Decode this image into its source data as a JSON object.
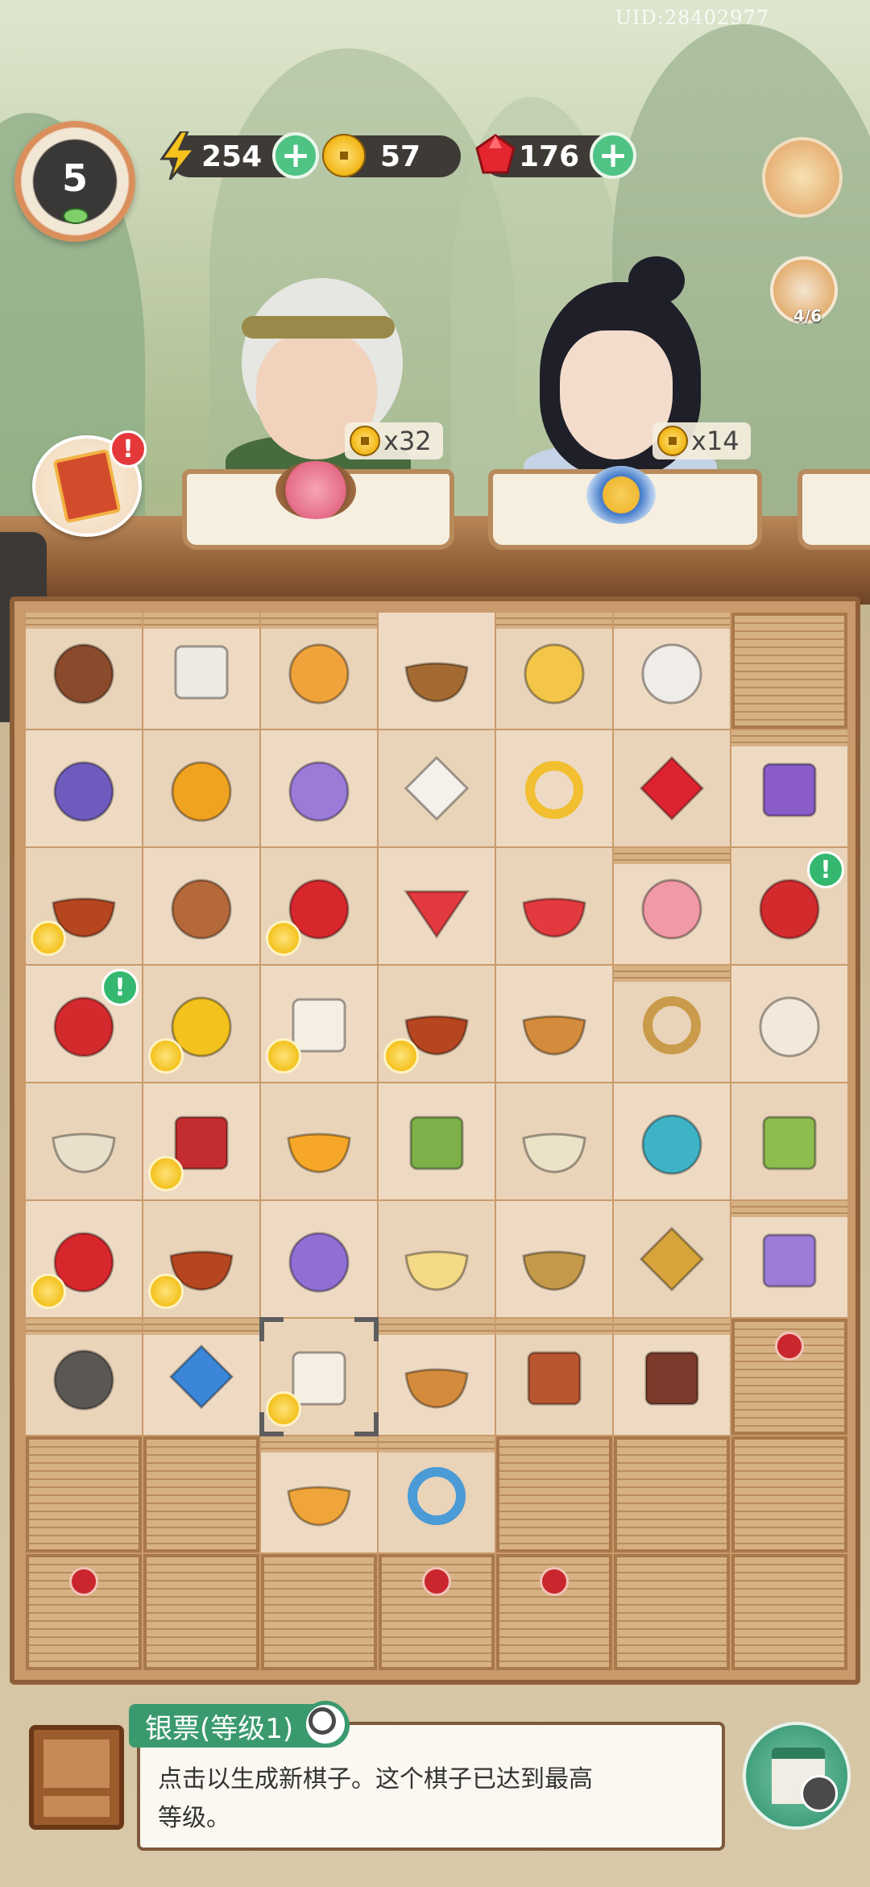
{
  "header": {
    "uid": "UID:28402977",
    "level": "5",
    "cat_progress": "4/6"
  },
  "currencies": [
    {
      "name": "energy",
      "icon": "lightning-icon",
      "value": "254",
      "has_plus": true
    },
    {
      "name": "coins",
      "icon": "copper-coin-icon",
      "value": "57",
      "has_plus": false
    },
    {
      "name": "gems",
      "icon": "ruby-icon",
      "value": "176",
      "has_plus": true
    }
  ],
  "orders": [
    {
      "customer": "elder-woman",
      "dish_icon": "pink-flower-dumpling-icon",
      "reward": "x32"
    },
    {
      "customer": "young-lady",
      "dish_icon": "blue-tea-cup-icon",
      "reward": "x14"
    }
  ],
  "board": {
    "rows": [
      [
        "nest-icon",
        "folded-cloth-icon",
        "orange-cat-icon",
        "incense-burner-icon",
        "chick-nest-icon",
        "silk-thread-icon",
        "locked"
      ],
      [
        "purple-energy-gourd-icon",
        "gold-energy-gourd-icon",
        "purple-pouch-icon",
        "rice-cake-icon",
        "gold-ring-icon",
        "ruby-gems-icon",
        "purple-bag-icon"
      ],
      [
        "picnic-basket-icon",
        "clay-gourd-icon",
        "fortune-boy-icon",
        "watermelon-slice-icon",
        "watermelon-wedge-icon",
        "peach-bun-icon",
        "red-tin-icon"
      ],
      [
        "red-tin-icon",
        "gold-coin-stack-icon",
        "silver-note-icon",
        "picnic-basket-icon",
        "dried-fish-bowl-icon",
        "brush-and-thread-icon",
        "cotton-spindle-icon"
      ],
      [
        "red-bean-soup-icon",
        "mystery-chest-icon",
        "porcelain-bowl-icon",
        "bamboo-icon",
        "rice-porridge-icon",
        "teapot-set-icon",
        "bamboo-bundle-icon"
      ],
      [
        "fortune-boy-icon",
        "picnic-basket-icon",
        "lavender-sachet-icon",
        "lotus-seed-soup-icon",
        "vegetable-basket-icon",
        "dried-leaves-icon",
        "purple-scroll-icon"
      ],
      [
        "gray-cat-icon",
        "blue-gem-icon",
        "silver-note-icon",
        "dried-fish-bowl-icon",
        "cinnamon-bundle-icon",
        "wooden-box-icon",
        "locked-knot"
      ],
      [
        "locked",
        "locked",
        "egg-fried-rice-icon",
        "jade-bracelet-icon",
        "locked",
        "locked",
        "locked"
      ],
      [
        "locked-knot",
        "locked",
        "locked",
        "locked-knot",
        "locked-knot",
        "locked",
        "locked"
      ]
    ]
  },
  "info_panel": {
    "title": "银票(等级1)",
    "description_line1": "点击以生成新棋子。这个棋子已达到最高",
    "description_line2": "等级。"
  },
  "colors": {
    "accent_green": "#3a9a6e",
    "alert_red": "#e5383b",
    "board_wood": "#c99a6b"
  }
}
